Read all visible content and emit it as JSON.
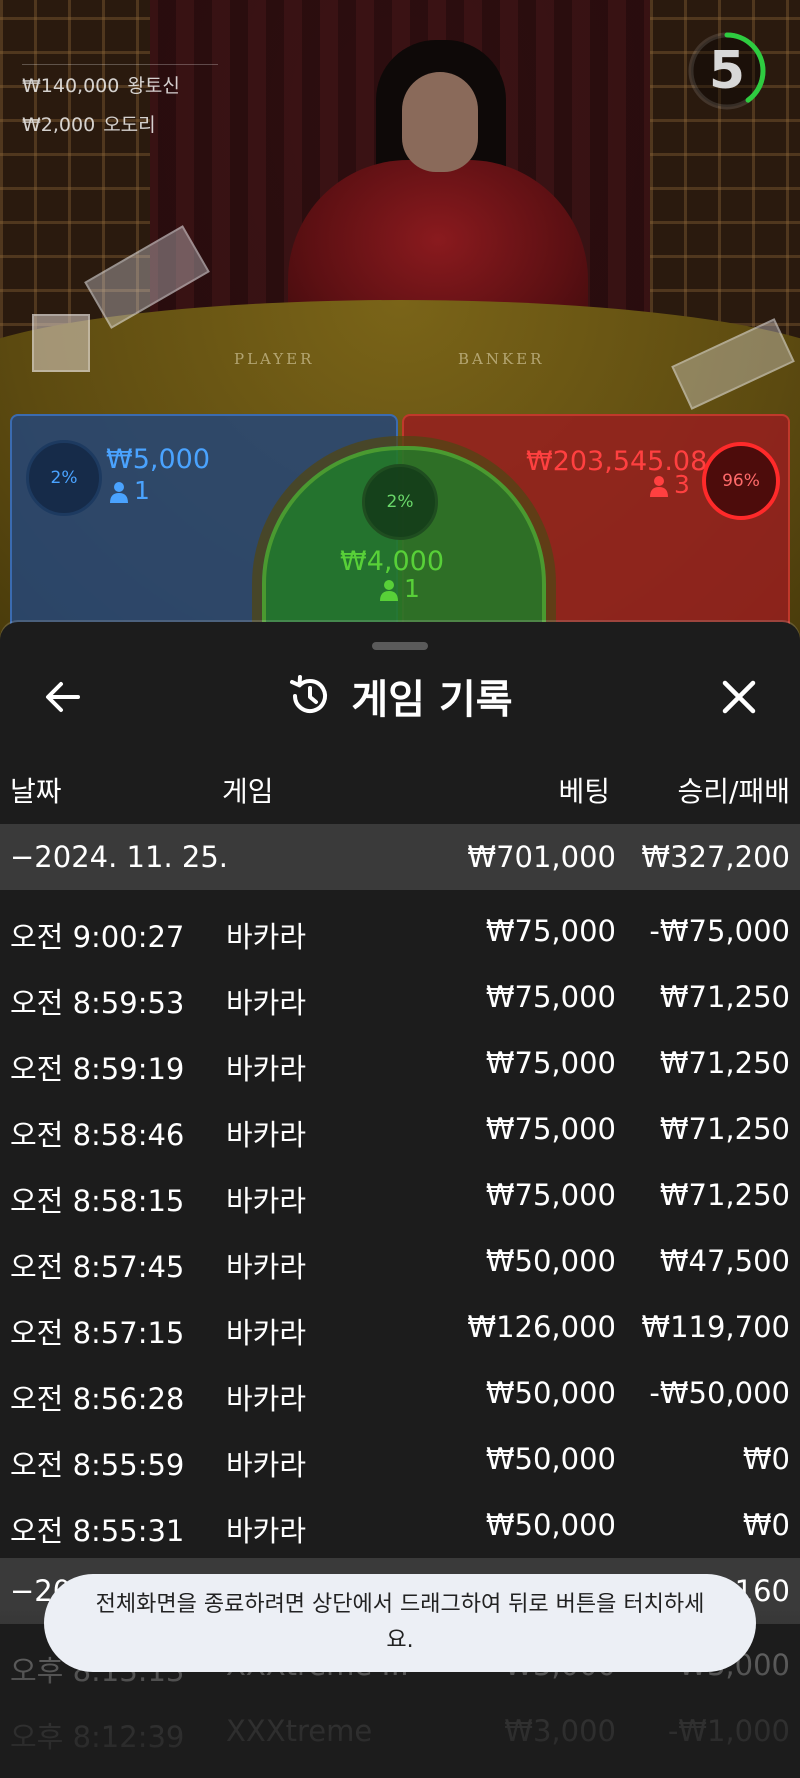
{
  "top_bets": [
    {
      "amount": "₩140,000",
      "name": "왕토신"
    },
    {
      "amount": "₩2,000",
      "name": "오도리"
    }
  ],
  "timer": {
    "value": "5",
    "fraction_remaining": 0.4
  },
  "table_labels": {
    "player": "PLAYER",
    "banker": "BANKER"
  },
  "bets": {
    "player": {
      "percent": "2%",
      "amount": "₩5,000",
      "count": "1",
      "color": "#4aa3ff"
    },
    "tie": {
      "percent": "2%",
      "amount": "₩4,000",
      "count": "1",
      "color": "#58d038"
    },
    "banker": {
      "percent": "96%",
      "amount": "₩203,545.08",
      "count": "3",
      "color": "#ff4040"
    }
  },
  "sheet": {
    "title": "게임 기록",
    "back_icon": "arrow-left-icon",
    "history_icon": "history-icon",
    "close_icon": "close-icon",
    "columns": {
      "date": "날짜",
      "game": "게임",
      "bet": "베팅",
      "result": "승리/패배"
    },
    "rows": [
      {
        "type": "group",
        "date": "−2024. 11. 25.",
        "game": "",
        "bet": "₩701,000",
        "result": "₩327,200"
      },
      {
        "type": "item",
        "date": "오전 9:00:27",
        "game": "바카라",
        "bet": "₩75,000",
        "result": "-₩75,000"
      },
      {
        "type": "item",
        "date": "오전 8:59:53",
        "game": "바카라",
        "bet": "₩75,000",
        "result": "₩71,250"
      },
      {
        "type": "item",
        "date": "오전 8:59:19",
        "game": "바카라",
        "bet": "₩75,000",
        "result": "₩71,250"
      },
      {
        "type": "item",
        "date": "오전 8:58:46",
        "game": "바카라",
        "bet": "₩75,000",
        "result": "₩71,250"
      },
      {
        "type": "item",
        "date": "오전 8:58:15",
        "game": "바카라",
        "bet": "₩75,000",
        "result": "₩71,250"
      },
      {
        "type": "item",
        "date": "오전 8:57:45",
        "game": "바카라",
        "bet": "₩50,000",
        "result": "₩47,500"
      },
      {
        "type": "item",
        "date": "오전 8:57:15",
        "game": "바카라",
        "bet": "₩126,000",
        "result": "₩119,700"
      },
      {
        "type": "item",
        "date": "오전 8:56:28",
        "game": "바카라",
        "bet": "₩50,000",
        "result": "-₩50,000"
      },
      {
        "type": "item",
        "date": "오전 8:55:59",
        "game": "바카라",
        "bet": "₩50,000",
        "result": "₩0"
      },
      {
        "type": "item",
        "date": "오전 8:55:31",
        "game": "바카라",
        "bet": "₩50,000",
        "result": "₩0"
      },
      {
        "type": "group",
        "date": "−20",
        "game": "",
        "bet": "",
        "result": "160"
      },
      {
        "type": "dim",
        "date": "오후 8:13:13",
        "game": "XXXtreme ...",
        "bet": "₩3,000",
        "result": "₩3,000"
      },
      {
        "type": "dim2",
        "date": "오후 8:12:39",
        "game": "XXXtreme",
        "bet": "₩3,000",
        "result": "-₩1,000"
      }
    ]
  },
  "toast": "전체화면을 종료하려면 상단에서 드래그하여 뒤로 버튼을 터치하세요."
}
